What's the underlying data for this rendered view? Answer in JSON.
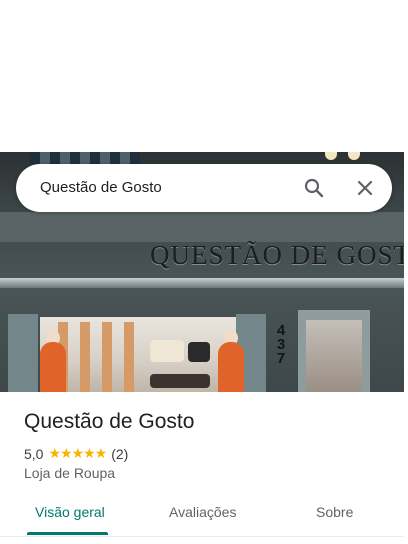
{
  "search": {
    "query": "Questão de Gosto",
    "icons": [
      "search-icon",
      "close-icon"
    ]
  },
  "photo": {
    "sign_text": "QUESTÃO DE GOSTO",
    "street_number": [
      "4",
      "3",
      "7"
    ]
  },
  "place": {
    "name": "Questão de Gosto",
    "rating": "5,0",
    "stars": "★★★★★",
    "star_fraction": 1.0,
    "reviews_count": "(2)",
    "category": "Loja de Roupa"
  },
  "tabs": [
    {
      "label": "Visão geral",
      "active": true
    },
    {
      "label": "Avaliações",
      "active": false
    },
    {
      "label": "Sobre",
      "active": false
    }
  ],
  "colors": {
    "accent": "#00796b",
    "star": "#f6b600",
    "text": "#202124",
    "muted": "#5f6368"
  }
}
